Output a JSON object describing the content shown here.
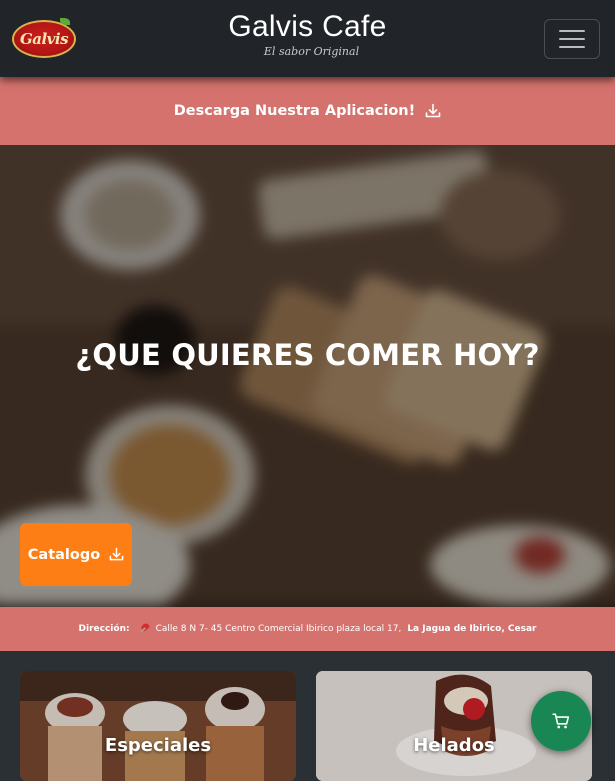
{
  "navbar": {
    "logo_text": "Galvis",
    "title": "Galvis Cafe",
    "subtitle": "El sabor Original",
    "menu_icon": "hamburger-menu-icon"
  },
  "download_bar": {
    "label": "Descarga Nuestra Aplicacion!",
    "icon": "download-icon"
  },
  "hero": {
    "title": "¿QUE QUIERES COMER HOY?",
    "catalog_button": {
      "label": "Catalogo",
      "icon": "download-icon"
    }
  },
  "address": {
    "label": "Dirección:",
    "icon": "pushpin-icon",
    "street": "Calle 8 N 7- 45 Centro Comercial Ibirico plaza local 17,",
    "city": "La Jagua de Ibirico, Cesar"
  },
  "categories": [
    {
      "label": "Especiales"
    },
    {
      "label": "Helados"
    }
  ],
  "cart_button": {
    "icon": "cart-icon"
  },
  "colors": {
    "navbar": "#212529",
    "banner": "#d5726d",
    "catalog_button": "#fd7e14",
    "cart_button": "#198754",
    "page_background": "#2b3035"
  }
}
